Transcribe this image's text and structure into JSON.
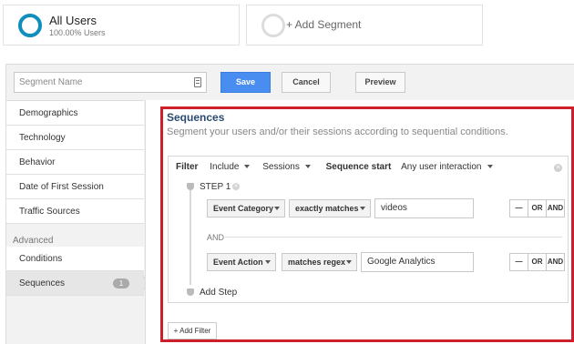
{
  "segments": [
    {
      "title": "All Users",
      "subtitle": "100.00% Users"
    },
    {
      "title": "+ Add Segment"
    }
  ],
  "toolbar": {
    "name_placeholder": "Segment Name",
    "save": "Save",
    "cancel": "Cancel",
    "preview": "Preview"
  },
  "sidebar": {
    "items": [
      "Demographics",
      "Technology",
      "Behavior",
      "Date of First Session",
      "Traffic Sources"
    ],
    "advanced_label": "Advanced",
    "advanced_items": [
      {
        "label": "Conditions"
      },
      {
        "label": "Sequences",
        "badge": "1"
      }
    ]
  },
  "sequences": {
    "title": "Sequences",
    "description": "Segment your users and/or their sessions according to sequential conditions.",
    "filter_label": "Filter",
    "include": "Include",
    "sessions": "Sessions",
    "sequence_start_label": "Sequence start",
    "sequence_start_value": "Any user interaction",
    "step_label": "STEP 1",
    "and_label": "AND",
    "conditions": [
      {
        "dimension": "Event Category",
        "operator": "exactly matches",
        "value": "videos"
      },
      {
        "dimension": "Event Action",
        "operator": "matches regex",
        "value": "Google Analytics"
      }
    ],
    "ops": [
      "—",
      "OR",
      "AND"
    ],
    "add_step": "Add Step",
    "add_filter": "+ Add Filter"
  },
  "colors": {
    "accent_blue": "#4a8df0",
    "ring_blue": "#0f8fb9",
    "highlight_red": "#cc1f2b",
    "title_blue": "#2a4b6f"
  }
}
